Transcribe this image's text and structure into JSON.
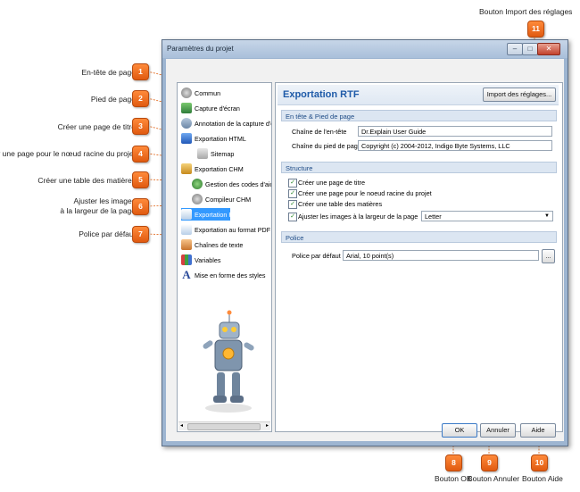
{
  "window": {
    "title": "Paramètres du projet"
  },
  "tree": [
    {
      "label": "Commun",
      "selected": false
    },
    {
      "label": "Capture d'écran",
      "selected": false
    },
    {
      "label": "Annotation de la capture d'écr",
      "selected": false
    },
    {
      "label": "Exportation HTML",
      "selected": false
    },
    {
      "label": "Sitemap",
      "selected": false
    },
    {
      "label": "Exportation CHM",
      "selected": false
    },
    {
      "label": "Gestion des codes d'aide",
      "selected": false
    },
    {
      "label": "Compileur CHM",
      "selected": false
    },
    {
      "label": "Exportation RTF",
      "selected": true
    },
    {
      "label": "Exportation au format PDF",
      "selected": false
    },
    {
      "label": "Chaînes de texte",
      "selected": false
    },
    {
      "label": "Variables",
      "selected": false
    },
    {
      "label": "Mise en forme des styles",
      "selected": false
    }
  ],
  "panel": {
    "title": "Exportation RTF",
    "import_button": "Import des réglages...",
    "header_footer_section": "En tête & Pied de page",
    "header_label": "Chaîne de l'en-tête",
    "header_value": "Dr.Explain User Guide",
    "footer_label": "Chaîne du pied de page",
    "footer_value": "Copyright (c) 2004-2012, Indigo Byte Systems, LLC",
    "structure_section": "Structure",
    "cb_title_page": "Créer une page de titre",
    "cb_root_page": "Créer une page pour le noeud racine du projet",
    "cb_toc": "Créer une table des matières",
    "cb_fit_images": "Ajuster les images à la largeur de la page",
    "page_size_value": "Letter",
    "font_section": "Police",
    "default_font_label": "Police par défaut",
    "default_font_value": "Arial, 10 point(s)",
    "browse_button": "..."
  },
  "footer_buttons": {
    "ok": "OK",
    "cancel": "Annuler",
    "help": "Aide"
  },
  "callouts": {
    "c1": "En-tête de page",
    "c2": "Pied de page",
    "c3": "Créer une page de titre",
    "c4": "Créer une page pour le nœud racine du projet",
    "c5": "Créer une table des matières",
    "c6a": "Ajuster les images",
    "c6b": "à la largeur de la page",
    "c7": "Police par défaut",
    "c8": "Bouton OK",
    "c9": "Bouton Annuler",
    "c10": "Bouton Aide",
    "c11": "Bouton Import des réglages"
  },
  "badges": [
    "1",
    "2",
    "3",
    "4",
    "5",
    "6",
    "7",
    "8",
    "9",
    "10",
    "11"
  ],
  "colors": {
    "badge": "#e8641c",
    "selection": "#3399ff",
    "panel_title": "#1e5aa8"
  }
}
